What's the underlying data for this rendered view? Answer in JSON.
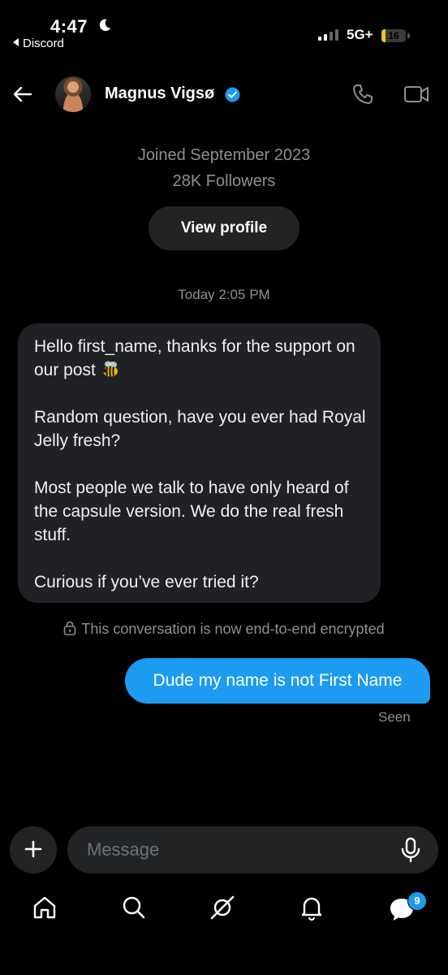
{
  "status_bar": {
    "time": "4:47",
    "back_app": "Discord",
    "network": "5G+",
    "battery": "16",
    "battery_level": 0.16
  },
  "header": {
    "name": "Magnus Vigsø",
    "verified": true,
    "icons": [
      "back-arrow-icon",
      "phone-icon",
      "video-icon"
    ]
  },
  "profile": {
    "joined": "Joined September 2023",
    "followers": "28K Followers",
    "view_profile_label": "View profile"
  },
  "conversation": {
    "date_label": "Today 2:05 PM",
    "incoming_paragraphs": [
      "Hello first_name, thanks for the support on our post",
      "Random question, have you ever had Royal Jelly fresh?",
      "Most people we talk to have only heard of the capsule version. We do the real fresh stuff.",
      "Curious if you’ve ever tried it?"
    ],
    "incoming_emoji": "bee-emoji",
    "encryption_notice": "This conversation is now end-to-end encrypted",
    "outgoing_text": "Dude my name is not First Name",
    "seen_label": "Seen"
  },
  "composer": {
    "placeholder": "Message"
  },
  "bottom_nav": {
    "items": [
      "home-icon",
      "search-icon",
      "grok-icon",
      "notifications-icon",
      "messages-icon"
    ],
    "messages_badge": "9"
  },
  "colors": {
    "background": "#000000",
    "accent": "#1d9bf0",
    "bubble_incoming": "#202124",
    "muted_text": "#8b9096"
  }
}
